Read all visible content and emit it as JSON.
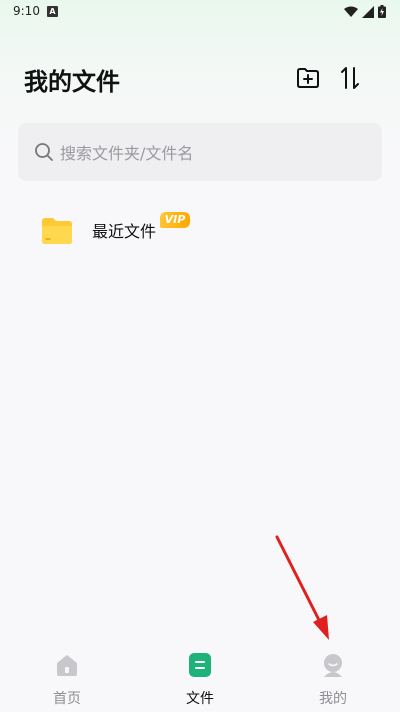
{
  "status": {
    "time": "9:10",
    "a_icon": "A"
  },
  "header": {
    "title": "我的文件",
    "add_icon": "folder-add-icon",
    "sort_icon": "sort-icon"
  },
  "search": {
    "placeholder": "搜索文件夹/文件名"
  },
  "list": [
    {
      "label": "最近文件",
      "badge": "VIP",
      "icon": "folder-icon"
    }
  ],
  "tabs": [
    {
      "label": "首页",
      "icon": "home-icon",
      "active": false
    },
    {
      "label": "文件",
      "icon": "file-icon",
      "active": true
    },
    {
      "label": "我的",
      "icon": "profile-icon",
      "active": false
    }
  ],
  "colors": {
    "accent": "#1db27a",
    "inactive": "#8e8e93",
    "folder": "#ffd23f",
    "vip": "#ffb300",
    "annotation": "#e02020"
  }
}
